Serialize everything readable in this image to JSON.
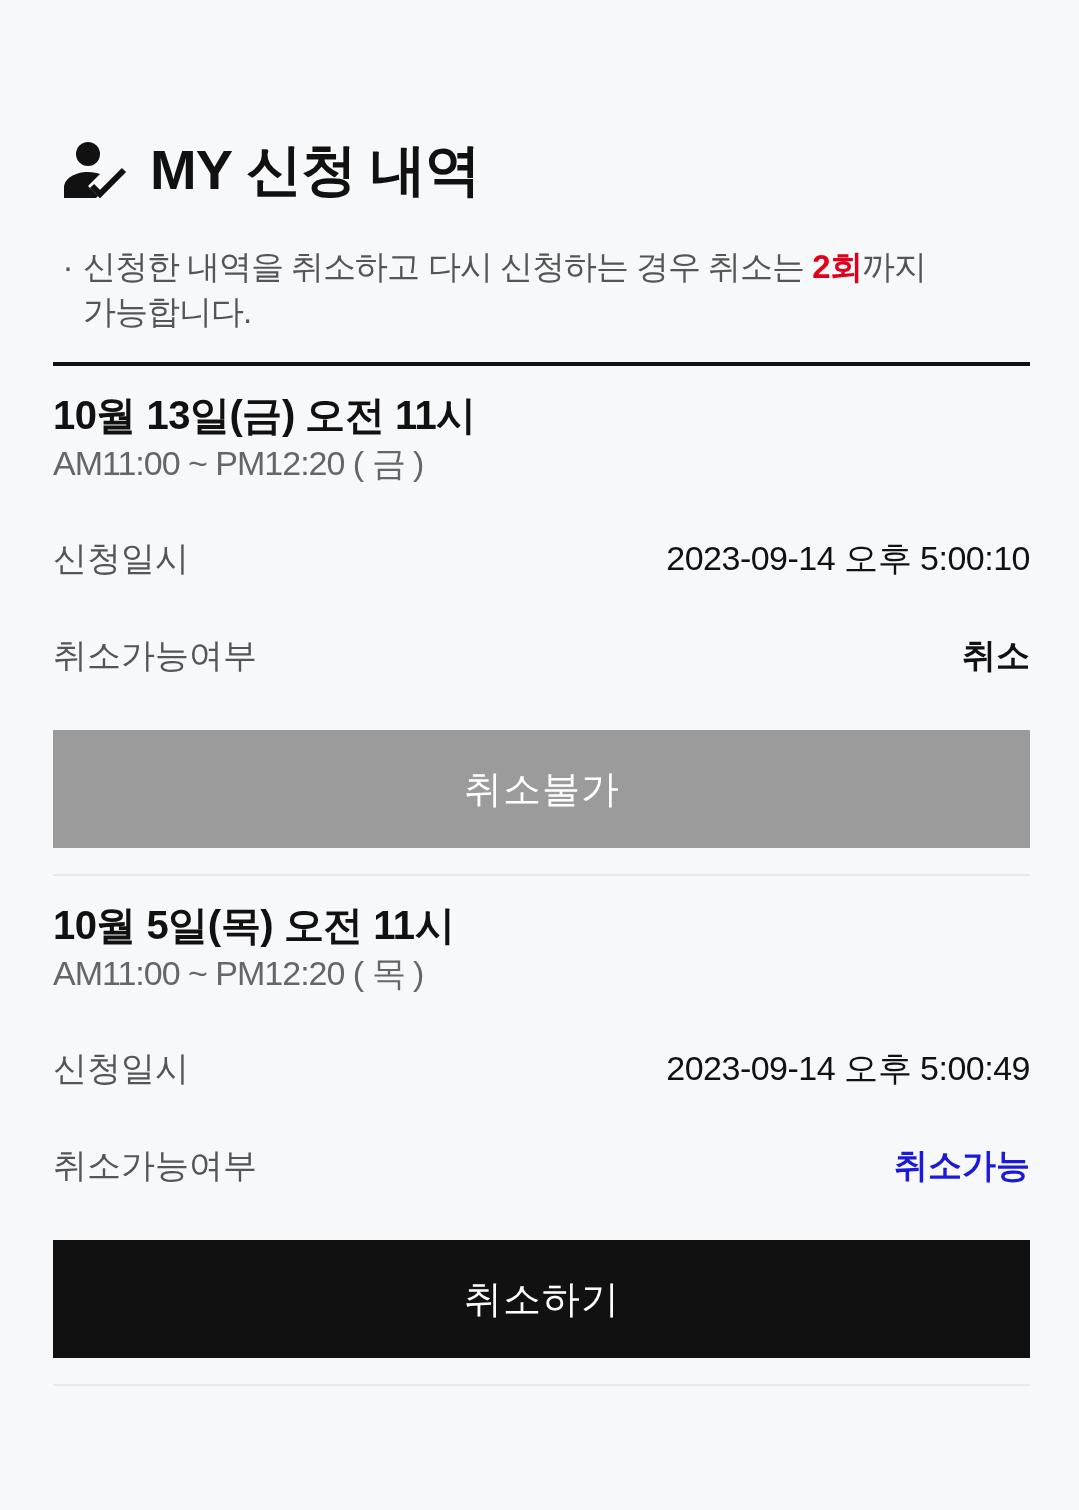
{
  "header": {
    "title": "MY 신청 내역"
  },
  "notice": {
    "bullet": "·",
    "text": "신청한 내역을 취소하고 다시 신청하는 경우 취소는 **2회**까지 가능합니다."
  },
  "applications": [
    {
      "title": "10월 13일(금) 오전 11시",
      "time": "AM11:00 ~ PM12:20 ( 금 )",
      "applied_label": "신청일시",
      "applied_at": "2023-09-14 오후 5:00:10",
      "status_label": "취소가능여부",
      "status": "취소",
      "cancelable": false,
      "button": "취소불가"
    },
    {
      "title": "10월 5일(목) 오전 11시",
      "time": "AM11:00 ~ PM12:20 ( 목 )",
      "applied_label": "신청일시",
      "applied_at": "2023-09-14 오후 5:00:49",
      "status_label": "취소가능여부",
      "status": "취소가능",
      "cancelable": true,
      "button": "취소하기"
    }
  ]
}
